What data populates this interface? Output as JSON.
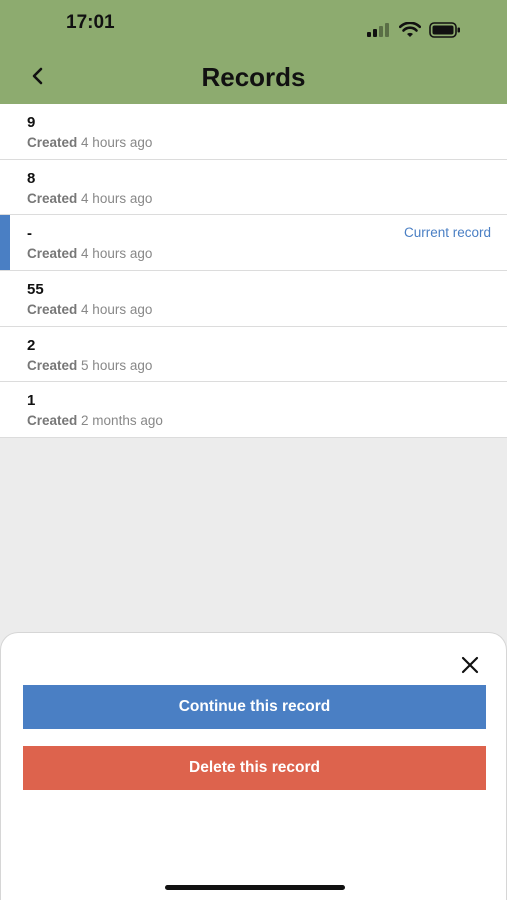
{
  "status_bar": {
    "time": "17:01",
    "icons": [
      "cellular-signal-icon",
      "wifi-icon",
      "battery-icon"
    ]
  },
  "header": {
    "title": "Records",
    "back_icon": "chevron-left-icon",
    "background": "#8dab6f"
  },
  "records": [
    {
      "name": "9",
      "created_label": "Created",
      "time": "4 hours ago",
      "badge": ""
    },
    {
      "name": "8",
      "created_label": "Created",
      "time": "4 hours ago",
      "badge": ""
    },
    {
      "name": "-",
      "created_label": "Created",
      "time": "4 hours ago",
      "badge": "Current record"
    },
    {
      "name": "55",
      "created_label": "Created",
      "time": "4 hours ago",
      "badge": ""
    },
    {
      "name": "2",
      "created_label": "Created",
      "time": "5 hours ago",
      "badge": ""
    },
    {
      "name": "1",
      "created_label": "Created",
      "time": "2 months ago",
      "badge": ""
    }
  ],
  "sheet": {
    "close_icon": "close-icon",
    "continue_label": "Continue this record",
    "delete_label": "Delete this record"
  },
  "colors": {
    "accent": "#4a7fc4",
    "danger": "#dd634d",
    "header": "#8dab6f"
  }
}
